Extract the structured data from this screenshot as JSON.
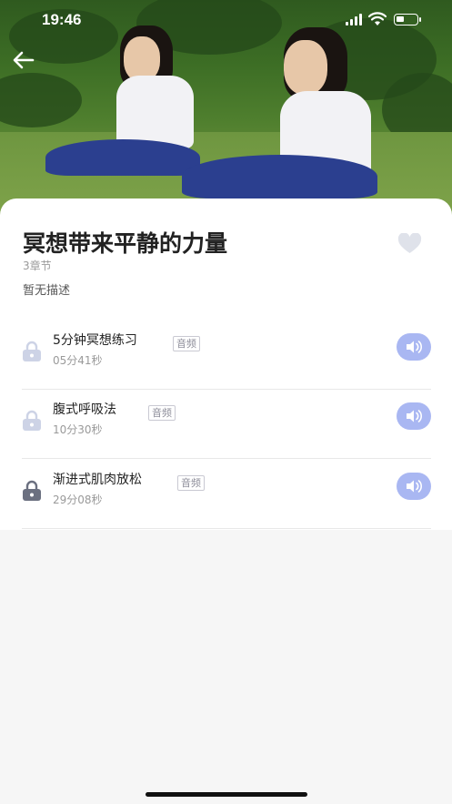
{
  "status_bar": {
    "time": "19:46"
  },
  "course": {
    "title": "冥想带来平静的力量",
    "chapter_count": "3章节",
    "description": "暂无描述",
    "favorited": false
  },
  "lessons": [
    {
      "title": "5分钟冥想练习",
      "duration": "05分41秒",
      "tag": "音频",
      "locked": false
    },
    {
      "title": "腹式呼吸法",
      "duration": "10分30秒",
      "tag": "音频",
      "locked": false
    },
    {
      "title": "渐进式肌肉放松",
      "duration": "29分08秒",
      "tag": "音频",
      "locked": true
    }
  ],
  "colors": {
    "play_button": "#a9b7f2",
    "lock_light": "#cdd3e6",
    "lock_dark": "#6b7080",
    "heart": "#dfe2ea"
  },
  "icons": {
    "back": "arrow-left-icon",
    "favorite": "heart-icon",
    "lock": "lock-icon",
    "play": "speaker-icon"
  }
}
